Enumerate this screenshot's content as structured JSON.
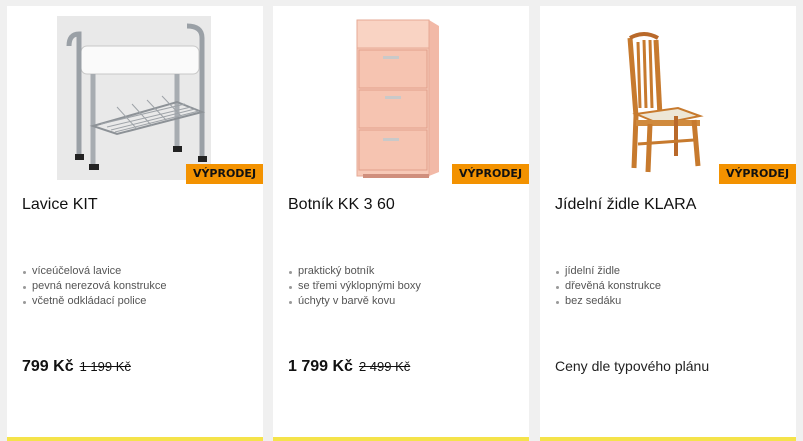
{
  "products": [
    {
      "title": "Lavice KIT",
      "badge": "VÝPRODEJ",
      "features": [
        "víceúčelová lavice",
        "pevná nerezová konstrukce",
        "včetně odkládací police"
      ],
      "price": "799 Kč",
      "old_price": "1 199 Kč"
    },
    {
      "title": "Botník KK 3 60",
      "badge": "VÝPRODEJ",
      "features": [
        "praktický botník",
        "se třemi výklopnými boxy",
        "úchyty v barvě kovu"
      ],
      "price": "1 799 Kč",
      "old_price": "2 499 Kč"
    },
    {
      "title": "Jídelní židle KLARA",
      "badge": "VÝPRODEJ",
      "features": [
        "jídelní židle",
        "dřevěná konstrukce",
        "bez sedáku"
      ],
      "price_note": "Ceny dle typového plánu"
    }
  ],
  "colors": {
    "badge": "#f39200",
    "accent_line": "#f5e34a",
    "background": "#f0f0f0"
  }
}
